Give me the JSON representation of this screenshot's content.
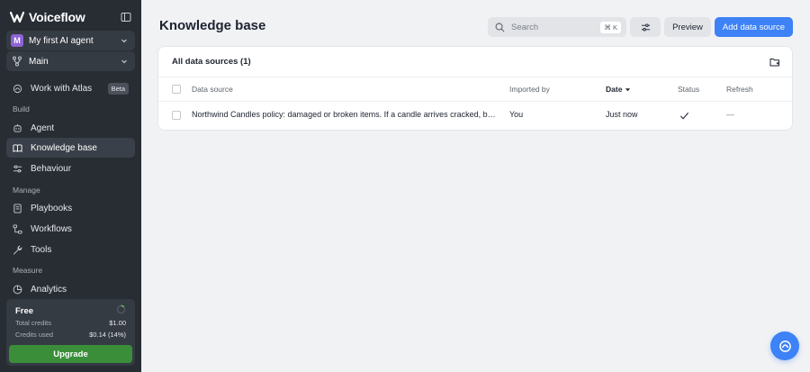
{
  "app": {
    "brand": "Voiceflow",
    "accent_color": "#3d82f6",
    "sidebar_bg": "#282d34"
  },
  "sidebar": {
    "agent": {
      "avatar_letter": "M",
      "name": "My first AI agent",
      "avatar_color": "#8e63d5"
    },
    "environment": {
      "name": "Main"
    },
    "atlas": {
      "label": "Work with Atlas",
      "badge": "Beta"
    },
    "sections": {
      "build": "Build",
      "manage": "Manage",
      "measure": "Measure"
    },
    "items": [
      {
        "label": "Agent",
        "icon": "agent-icon"
      },
      {
        "label": "Knowledge base",
        "icon": "book-icon",
        "active": true
      },
      {
        "label": "Behaviour",
        "icon": "sliders-icon"
      },
      {
        "label": "Playbooks",
        "icon": "playbook-icon"
      },
      {
        "label": "Workflows",
        "icon": "workflow-icon"
      },
      {
        "label": "Tools",
        "icon": "wrench-icon"
      },
      {
        "label": "Analytics",
        "icon": "analytics-icon"
      }
    ],
    "plan": {
      "name": "Free",
      "total_credits_label": "Total credits",
      "total_credits_value": "$1.00",
      "credits_used_label": "Credits used",
      "credits_used_value": "$0.14 (14%)",
      "credits_used_fraction": 0.14,
      "upgrade_label": "Upgrade",
      "upgrade_color": "#3a8e3a"
    }
  },
  "header": {
    "title": "Knowledge base",
    "search_placeholder": "Search",
    "search_shortcut": "⌘ K",
    "preview_label": "Preview",
    "add_label": "Add data source"
  },
  "table": {
    "title": "All data sources (1)",
    "columns": {
      "source": "Data source",
      "imported_by": "Imported by",
      "date": "Date",
      "status": "Status",
      "refresh": "Refresh"
    },
    "rows": [
      {
        "source": "Northwind Candles policy: damaged or broken items. If a candle arrives cracked, broken, or leaking wax, please contact support.",
        "imported_by": "You",
        "date": "Just now",
        "status": "check-icon",
        "refresh": "—"
      }
    ]
  }
}
